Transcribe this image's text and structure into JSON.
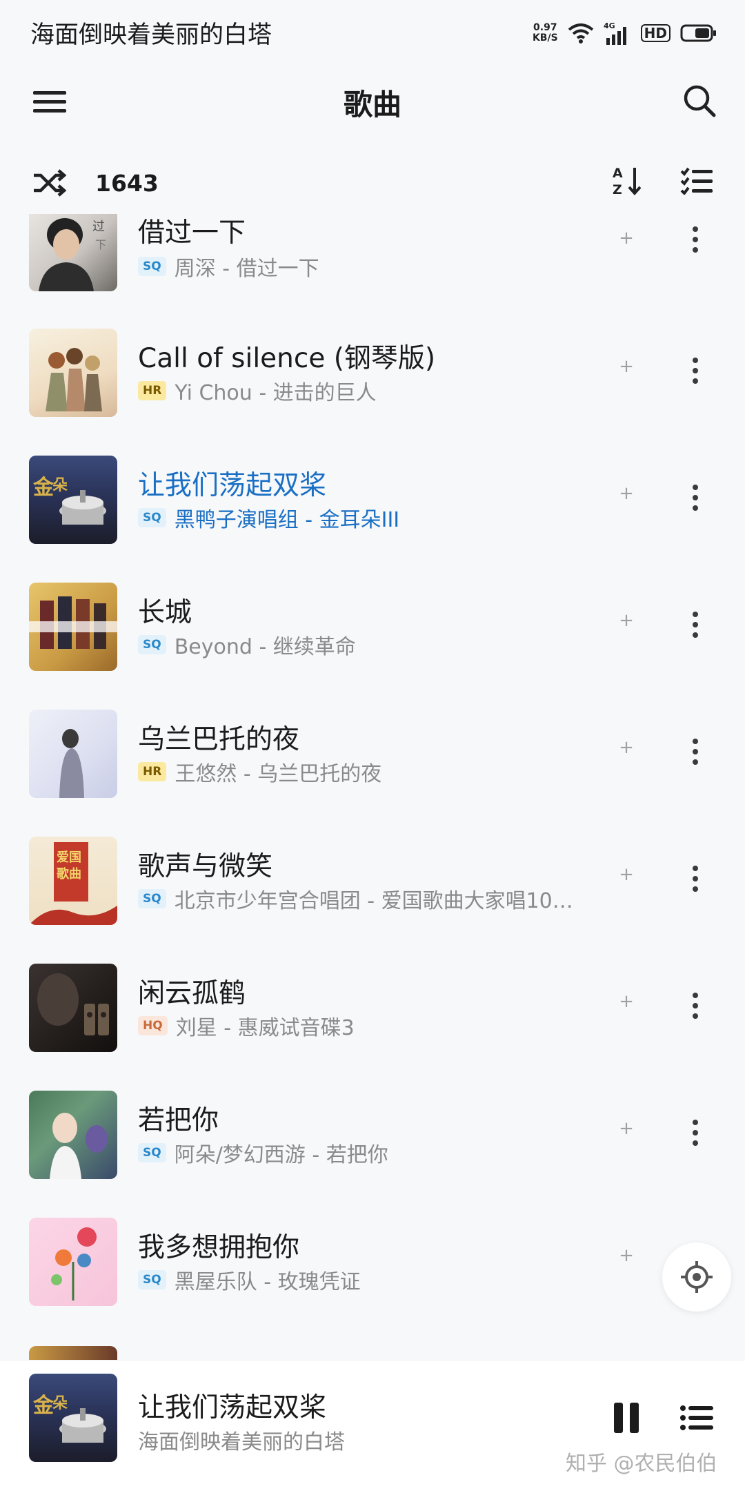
{
  "status_bar": {
    "notification": "海面倒映着美丽的白塔",
    "net_speed_value": "0.97",
    "net_speed_unit": "KB/S",
    "net_type": "4G",
    "hd": "HD"
  },
  "header": {
    "title": "歌曲"
  },
  "toolbar": {
    "count": "1643"
  },
  "songs": [
    {
      "title": "借过一下",
      "quality": "SQ",
      "subtitle": "周深 - 借过一下",
      "active": false
    },
    {
      "title": "Call of silence (钢琴版)",
      "quality": "HR",
      "subtitle": "Yi Chou - 进击的巨人",
      "active": false
    },
    {
      "title": "让我们荡起双桨",
      "quality": "SQ",
      "subtitle": "黑鸭子演唱组 - 金耳朵III",
      "active": true
    },
    {
      "title": "长城",
      "quality": "SQ",
      "subtitle": "Beyond - 继续革命",
      "active": false
    },
    {
      "title": "乌兰巴托的夜",
      "quality": "HR",
      "subtitle": "王悠然 - 乌兰巴托的夜",
      "active": false
    },
    {
      "title": "歌声与微笑",
      "quality": "SQ",
      "subtitle": "北京市少年宫合唱团 - 爱国歌曲大家唱100...",
      "active": false
    },
    {
      "title": "闲云孤鹤",
      "quality": "HQ",
      "subtitle": "刘星 - 惠威试音碟3",
      "active": false
    },
    {
      "title": "若把你",
      "quality": "SQ",
      "subtitle": "阿朵/梦幻西游 - 若把你",
      "active": false
    },
    {
      "title": "我多想拥抱你",
      "quality": "SQ",
      "subtitle": "黑屋乐队 - 玫瑰凭证",
      "active": false
    }
  ],
  "row_plus": "+",
  "now_playing": {
    "title": "让我们荡起双桨",
    "subtitle": "海面倒映着美丽的白塔"
  },
  "watermark": "知乎 @农民伯伯",
  "colors": {
    "accent": "#1a6fc4",
    "background": "#f7f8fa",
    "sq_badge": "#2a88c9",
    "hr_badge": "#fbe9a0",
    "hq_badge": "#c96a3a"
  },
  "icons": [
    "menu-icon",
    "search-icon",
    "shuffle-icon",
    "sort-az-icon",
    "multi-select-icon",
    "more-icon",
    "locate-icon",
    "pause-icon",
    "playlist-icon"
  ]
}
